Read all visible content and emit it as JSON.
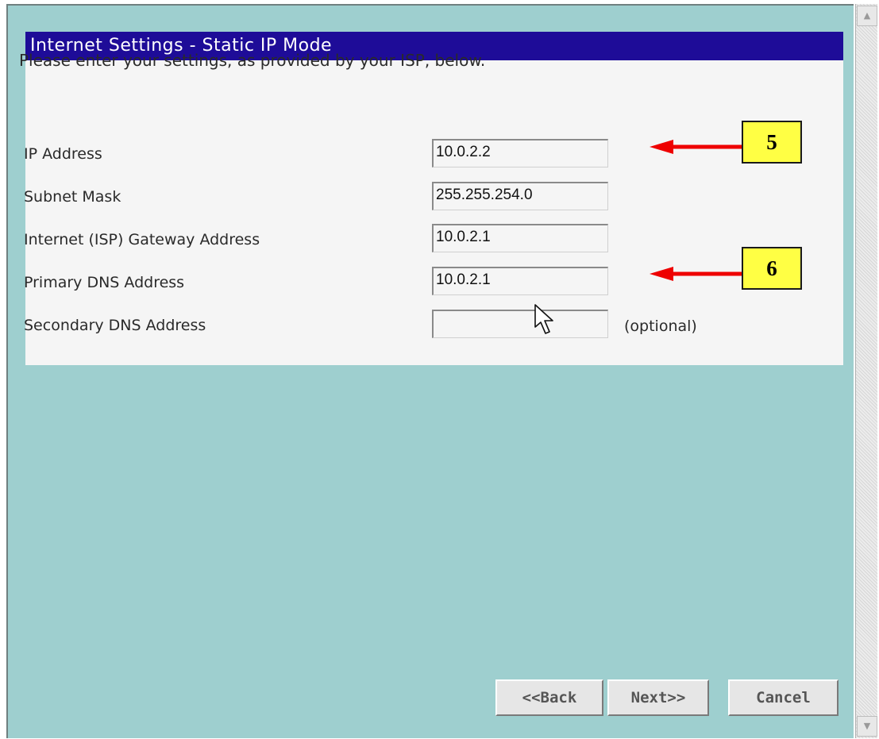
{
  "panel": {
    "title": "Internet Settings - Static IP Mode",
    "intro": "Please enter your settings, as provided by your ISP, below."
  },
  "fields": [
    {
      "label": "IP Address",
      "value": "10.0.2.2"
    },
    {
      "label": "Subnet Mask",
      "value": "255.255.254.0"
    },
    {
      "label": "Internet (ISP) Gateway Address",
      "value": "10.0.2.1"
    },
    {
      "label": "Primary DNS Address",
      "value": "10.0.2.1"
    },
    {
      "label": "Secondary DNS Address",
      "value": ""
    }
  ],
  "optional_note": "(optional)",
  "callouts": {
    "first": "5",
    "second": "6"
  },
  "buttons": {
    "back": "<<Back",
    "next": "Next>>",
    "cancel": "Cancel"
  },
  "colors": {
    "title_bar": "#1e0c98",
    "background": "#9ecfcf",
    "callout": "#ffff44",
    "arrow": "#ee0000"
  },
  "icons": {
    "cursor": "mouse-pointer-icon",
    "scroll_up": "arrow-up-icon",
    "scroll_down": "arrow-down-icon"
  }
}
